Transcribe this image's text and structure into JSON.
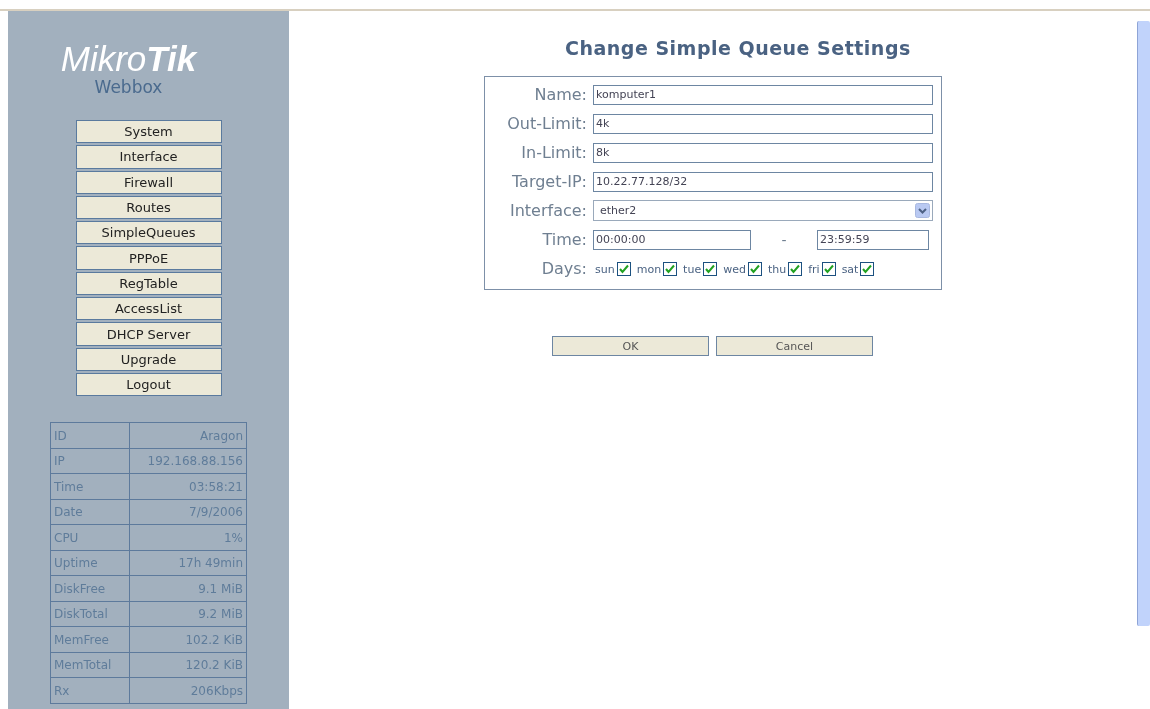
{
  "sidebar": {
    "logo": "Mikro**Tik**",
    "subtitle": "Webbox",
    "menu": [
      {
        "label": "System"
      },
      {
        "label": "Interface"
      },
      {
        "label": "Firewall"
      },
      {
        "label": "Routes"
      },
      {
        "label": "SimpleQueues"
      },
      {
        "label": "PPPoE"
      },
      {
        "label": "RegTable"
      },
      {
        "label": "AccessList"
      },
      {
        "label": "DHCP Server"
      },
      {
        "label": "Upgrade"
      },
      {
        "label": "Logout"
      }
    ],
    "info": [
      [
        "ID",
        "Aragon"
      ],
      [
        "IP",
        "192.168.88.156"
      ],
      [
        "Time",
        "03:58:21"
      ],
      [
        "Date",
        "7/9/2006"
      ],
      [
        "CPU",
        "1%"
      ],
      [
        "Uptime",
        "17h 49min"
      ],
      [
        "DiskFree",
        "9.1 MiB"
      ],
      [
        "DiskTotal",
        "9.2 MiB"
      ],
      [
        "MemFree",
        "102.2 KiB"
      ],
      [
        "MemTotal",
        "120.2 KiB"
      ],
      [
        "Rx",
        "206Kbps"
      ]
    ]
  },
  "title": "Change Simple Queue Settings",
  "form": [
    {
      "kind": "text",
      "label": "Name:",
      "value": "komputer1"
    },
    {
      "kind": "text",
      "label": "Out-Limit:",
      "value": "4k"
    },
    {
      "kind": "text",
      "label": "In-Limit:",
      "value": "8k"
    },
    {
      "kind": "text",
      "label": "Target-IP:",
      "value": "10.22.77.128/32"
    },
    {
      "kind": "select",
      "label": "Interface:",
      "value": "ether2"
    },
    {
      "kind": "range",
      "label": "Time:",
      "from": "00:00:00",
      "separator": "-",
      "to": "23:59:59"
    },
    {
      "kind": "days",
      "label": "Days:",
      "days": [
        {
          "label": "sun",
          "checked": true
        },
        {
          "label": "mon",
          "checked": true
        },
        {
          "label": "tue",
          "checked": true
        },
        {
          "label": "wed",
          "checked": true
        },
        {
          "label": "thu",
          "checked": true
        },
        {
          "label": "fri",
          "checked": true
        },
        {
          "label": "sat",
          "checked": true
        }
      ]
    }
  ],
  "buttons": [
    "OK",
    "Cancel"
  ]
}
